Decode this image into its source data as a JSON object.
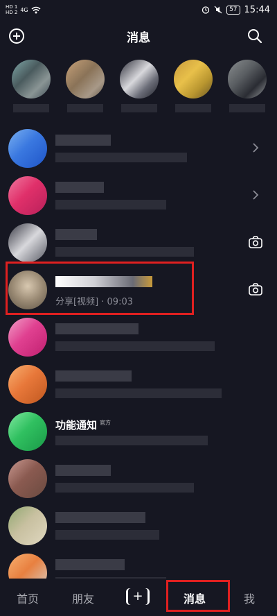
{
  "status_bar": {
    "hd1": "HD 1",
    "hd2": "HD 2",
    "signal": "4G",
    "battery": "57",
    "time": "15:44"
  },
  "header": {
    "title": "消息",
    "add_icon": "plus-circle-icon",
    "search_icon": "search-icon"
  },
  "chats": [
    {
      "name": "",
      "preview": "",
      "trail_icon": "chevron-right-icon"
    },
    {
      "name": "",
      "preview": "",
      "trail_icon": "chevron-right-icon"
    },
    {
      "name": "",
      "preview": "",
      "trail_icon": "camera-icon"
    },
    {
      "name": "",
      "preview": "分享[视频] · 09:03",
      "trail_icon": "camera-icon"
    },
    {
      "name": "",
      "preview": ""
    },
    {
      "name": "",
      "preview": ""
    },
    {
      "name": "功能通知",
      "tag": "官方",
      "preview": ""
    },
    {
      "name": "",
      "preview": ""
    },
    {
      "name": "",
      "preview": ""
    },
    {
      "name": "",
      "preview": ""
    }
  ],
  "bottom_nav": {
    "home": "首页",
    "friends": "朋友",
    "plus": "+",
    "messages": "消息",
    "me": "我"
  },
  "colors": {
    "background": "#161722",
    "highlight": "#e02020",
    "preview_text": "#8b8c96"
  }
}
